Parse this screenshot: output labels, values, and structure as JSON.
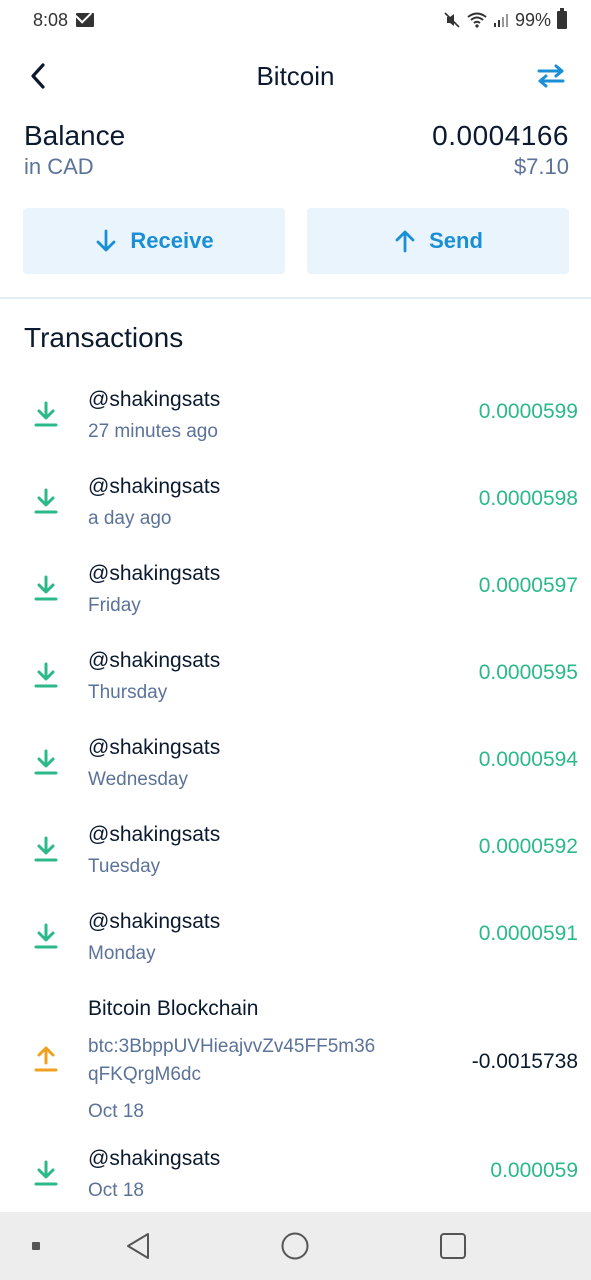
{
  "status_bar": {
    "time": "8:08",
    "battery": "99%"
  },
  "header": {
    "title": "Bitcoin"
  },
  "balance": {
    "label": "Balance",
    "currency_label": "in CAD",
    "amount": "0.0004166",
    "fiat": "$7.10"
  },
  "actions": {
    "receive_label": "Receive",
    "send_label": "Send"
  },
  "transactions": {
    "heading": "Transactions",
    "items": [
      {
        "name": "@shakingsats",
        "time": "27 minutes ago",
        "amount": "0.0000599",
        "direction": "in"
      },
      {
        "name": "@shakingsats",
        "time": "a day ago",
        "amount": "0.0000598",
        "direction": "in"
      },
      {
        "name": "@shakingsats",
        "time": "Friday",
        "amount": "0.0000597",
        "direction": "in"
      },
      {
        "name": "@shakingsats",
        "time": "Thursday",
        "amount": "0.0000595",
        "direction": "in"
      },
      {
        "name": "@shakingsats",
        "time": "Wednesday",
        "amount": "0.0000594",
        "direction": "in"
      },
      {
        "name": "@shakingsats",
        "time": "Tuesday",
        "amount": "0.0000592",
        "direction": "in"
      },
      {
        "name": "@shakingsats",
        "time": "Monday",
        "amount": "0.0000591",
        "direction": "in"
      },
      {
        "name": "Bitcoin Blockchain",
        "address": "btc:3BbppUVHieajvvZv45FF5m36qFKQrgM6dc",
        "time": "Oct 18",
        "amount": "-0.0015738",
        "direction": "out"
      },
      {
        "name": "@shakingsats",
        "time": "Oct 18",
        "amount": "0.000059",
        "direction": "in"
      }
    ]
  },
  "colors": {
    "accent": "#1a8fd6",
    "incoming": "#2bb98a",
    "outgoing": "#f0a020",
    "muted": "#5b7399"
  }
}
